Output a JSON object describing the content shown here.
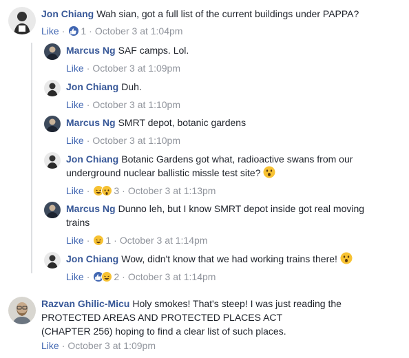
{
  "comments": [
    {
      "author": "Jon Chiang",
      "text": "Wah sian, got a full list of the current buildings under PAPPA?",
      "like": "Like",
      "reaction_count": "1",
      "time": "October 3 at 1:04pm"
    },
    {
      "author": "Marcus Ng",
      "text": "SAF camps. Lol.",
      "like": "Like",
      "time": "October 3 at 1:09pm"
    },
    {
      "author": "Jon Chiang",
      "text": "Duh.",
      "like": "Like",
      "time": "October 3 at 1:10pm"
    },
    {
      "author": "Marcus Ng",
      "text": "SMRT depot, botanic gardens",
      "like": "Like",
      "time": "October 3 at 1:10pm"
    },
    {
      "author": "Jon Chiang",
      "text_line1": "Botanic Gardens got what, radioactive swans from our",
      "text_line2": "underground nuclear ballistic missle test site?",
      "like": "Like",
      "reaction_count": "3",
      "time": "October 3 at 1:13pm"
    },
    {
      "author": "Marcus Ng",
      "text_line1": "Dunno leh, but I know SMRT depot inside got real moving",
      "text_line2": "trains",
      "like": "Like",
      "reaction_count": "1",
      "time": "October 3 at 1:14pm"
    },
    {
      "author": "Jon Chiang",
      "text": "Wow, didn't know that we had working trains there!",
      "like": "Like",
      "reaction_count": "2",
      "time": "October 3 at 1:14pm"
    },
    {
      "author": "Razvan Ghilic-Micu",
      "text_line1": "Holy smokes! That's steep! I was just reading the",
      "text_line2": "PROTECTED AREAS AND PROTECTED PLACES ACT",
      "text_line3": "(CHAPTER 256) hoping to find a clear list of such places.",
      "like": "Like",
      "time": "October 3 at 1:09pm"
    }
  ],
  "separator": "·",
  "colors": {
    "author": "#385898",
    "link": "#4267b2",
    "meta": "#90949c",
    "thread_line": "#dddfe2",
    "like_reaction": "#4267b2",
    "emoji_yellow": "#f7c233"
  }
}
